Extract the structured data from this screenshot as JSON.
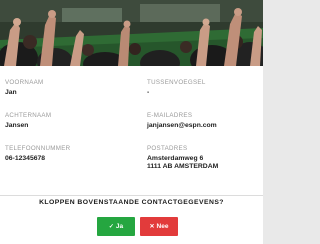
{
  "hero": {
    "image_name": "football-stadium-crowd-image",
    "colors": {
      "pitch": "#2f6b34",
      "sky": "#3b4a3d",
      "skin": "#c99c86"
    }
  },
  "contact": {
    "first_name": {
      "label": "VOORNAAM",
      "value": "Jan"
    },
    "infix": {
      "label": "TUSSENVOEGSEL",
      "value": "-"
    },
    "last_name": {
      "label": "ACHTERNAAM",
      "value": "Jansen"
    },
    "email": {
      "label": "E-MAILADRES",
      "value": "janjansen@espn.com"
    },
    "phone": {
      "label": "TELEFOONNUMMER",
      "value": "06-12345678"
    },
    "address": {
      "label": "POSTADRES",
      "line1": "Amsterdamweg 6",
      "line2": "1111 AB AMSTERDAM"
    }
  },
  "confirm": {
    "question": "KLOPPEN BOVENSTAANDE CONTACTGEGEVENS?",
    "yes_icon": "check-icon",
    "yes_glyph": "✓",
    "yes_label": "Ja",
    "no_icon": "close-icon",
    "no_glyph": "✕",
    "no_label": "Nee",
    "yes_color": "#25a640",
    "no_color": "#e23b3b"
  }
}
